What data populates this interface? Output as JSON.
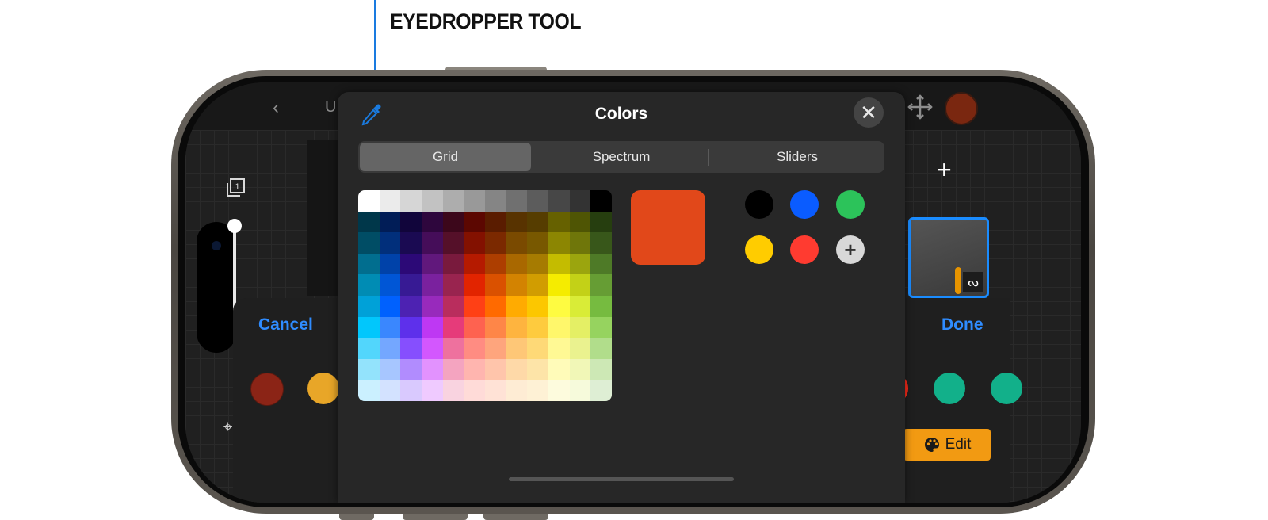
{
  "callout": {
    "label": "EYEDROPPER TOOL"
  },
  "topbar": {
    "back_glyph": "‹",
    "partial_label": "U"
  },
  "sidebar": {
    "layers_glyph": "1",
    "bottom_glyph": "⌖"
  },
  "colors_popover": {
    "title": "Colors",
    "close_glyph": "✕",
    "tabs": [
      {
        "label": "Grid",
        "active": true
      },
      {
        "label": "Spectrum",
        "active": false
      },
      {
        "label": "Sliders",
        "active": false
      }
    ],
    "current_color": "#e1481a",
    "grid_colors": [
      [
        "#ffffff",
        "#ebebeb",
        "#d6d6d6",
        "#c2c2c2",
        "#adadad",
        "#999999",
        "#858585",
        "#707070",
        "#5c5c5c",
        "#474747",
        "#333333",
        "#000000"
      ],
      [
        "#00374a",
        "#011d57",
        "#11053b",
        "#2e063d",
        "#3c071b",
        "#5c0701",
        "#5a1c00",
        "#583300",
        "#563d00",
        "#666100",
        "#4f5504",
        "#263e0f"
      ],
      [
        "#004d65",
        "#012f7b",
        "#1a0a52",
        "#450d59",
        "#551029",
        "#831100",
        "#7b2900",
        "#7a4a00",
        "#785800",
        "#8c8602",
        "#6f760a",
        "#38571a"
      ],
      [
        "#016e8f",
        "#0042a9",
        "#2c0977",
        "#61187c",
        "#791a3d",
        "#b51a00",
        "#ad3e00",
        "#a96800",
        "#a67b01",
        "#c4bc00",
        "#9ba50e",
        "#4e7a27"
      ],
      [
        "#008cb4",
        "#0056d6",
        "#371a94",
        "#7a219e",
        "#99244f",
        "#e22400",
        "#da5100",
        "#d38301",
        "#d19d01",
        "#f5ec00",
        "#c3d117",
        "#669d34"
      ],
      [
        "#00a1d8",
        "#0061fe",
        "#4d22b2",
        "#982abc",
        "#b92d5d",
        "#ff4015",
        "#ff6a00",
        "#ffab01",
        "#fcc700",
        "#fefb41",
        "#d9ec37",
        "#76bb40"
      ],
      [
        "#01c7fc",
        "#3a87fe",
        "#5e30eb",
        "#be38f3",
        "#e63b7a",
        "#fe6250",
        "#fe8648",
        "#feb43f",
        "#fecb3e",
        "#fff76b",
        "#e4ef65",
        "#96d35f"
      ],
      [
        "#52d6fc",
        "#74a7ff",
        "#864ffe",
        "#d357fe",
        "#ee719e",
        "#ff8c82",
        "#fea57d",
        "#fec777",
        "#fed977",
        "#fff994",
        "#eaf28f",
        "#b1dd8b"
      ],
      [
        "#93e3fc",
        "#a7c6ff",
        "#b18cfe",
        "#e292fe",
        "#f4a4c0",
        "#ffb5af",
        "#ffc5ab",
        "#fed9a8",
        "#fde4a8",
        "#fffbb9",
        "#f1f7b7",
        "#cde8b5"
      ],
      [
        "#cbf0ff",
        "#d3e2ff",
        "#d9c9fe",
        "#efcaff",
        "#f9d3e0",
        "#ffdbd8",
        "#ffe2d6",
        "#feecd4",
        "#fef1d5",
        "#fdfbdd",
        "#f6fadb",
        "#deeed4"
      ]
    ],
    "history_colors": [
      "#000000",
      "#0a5cff",
      "#2cc35a",
      "#ffcc00",
      "#ff3b30"
    ],
    "history_add_glyph": "+"
  },
  "right_panel": {
    "plus_glyph": "+",
    "layer_badge_glyph": "ᔓ"
  },
  "palette": {
    "cancel_label": "Cancel",
    "done_label": "Done",
    "edit_label": "Edit",
    "left_swatches": [
      "#8b2416",
      "#e8a628"
    ],
    "right_swatches": [
      "#ff2a1a",
      "#12b08a",
      "#12b08a"
    ]
  }
}
